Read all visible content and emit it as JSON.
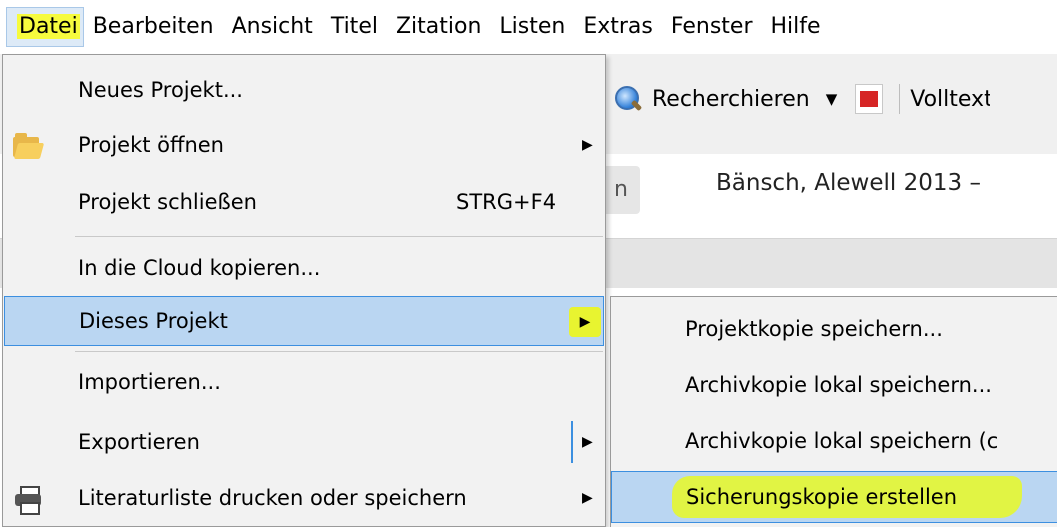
{
  "menubar": {
    "items": [
      "Datei",
      "Bearbeiten",
      "Ansicht",
      "Titel",
      "Zitation",
      "Listen",
      "Extras",
      "Fenster",
      "Hilfe"
    ]
  },
  "toolbar": {
    "search_label": "Recherchieren",
    "fulltext_label": "Volltext"
  },
  "content": {
    "ghost_button_text": "n",
    "reference_title": "Bänsch, Alewell 2013 –"
  },
  "datei_menu": {
    "items": [
      {
        "label": "Neues Projekt..."
      },
      {
        "label": "Projekt öffnen",
        "icon": "folder-open-icon"
      },
      {
        "label": "Projekt schließen",
        "shortcut": "STRG+F4"
      },
      {
        "label": "In die Cloud kopieren..."
      },
      {
        "label": "Dieses Projekt"
      },
      {
        "label": "Importieren..."
      },
      {
        "label": "Exportieren"
      },
      {
        "label": "Literaturliste drucken oder speichern",
        "icon": "printer-icon"
      }
    ]
  },
  "submenu": {
    "items": [
      {
        "label": "Projektkopie speichern..."
      },
      {
        "label": "Archivkopie lokal speichern..."
      },
      {
        "label": "Archivkopie lokal speichern (c"
      },
      {
        "label": "Sicherungskopie erstellen"
      }
    ]
  },
  "colors": {
    "highlight_yellow": "#f6fb3e",
    "selection_blue": "#bad6f2",
    "selection_border": "#3c8fe0"
  }
}
